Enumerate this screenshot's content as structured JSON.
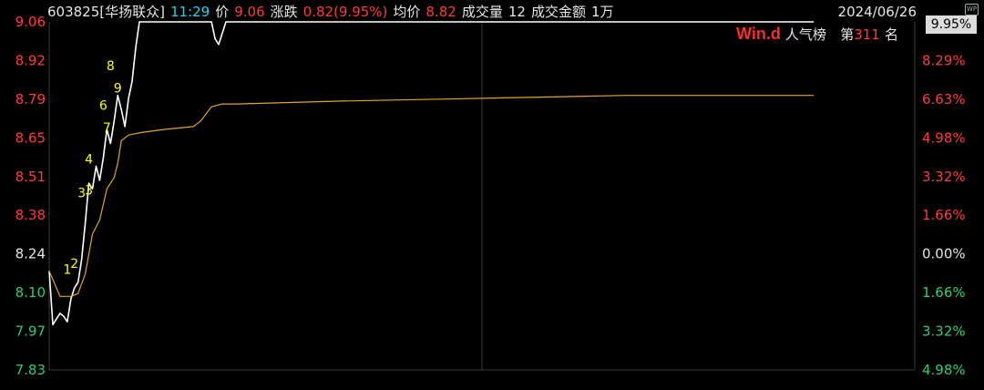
{
  "header": {
    "code_name": "603825[华扬联众]",
    "time": "11:29",
    "price_label": "价",
    "price": "9.06",
    "change_label": "涨跌",
    "change": "0.82(9.95%)",
    "avg_label": "均价",
    "avg": "8.82",
    "volume_label": "成交量",
    "volume": "12",
    "amount_label": "成交金额",
    "amount": "1万",
    "date": "2024/06/26",
    "wp_badge": "WP"
  },
  "current_pct_box": "9.95%",
  "popularity": {
    "brand": "Win.d",
    "label": "人气榜",
    "prefix": "第",
    "rank": "311",
    "suffix": "名"
  },
  "colors": {
    "up": "#ff3a3a",
    "down": "#2ecc71",
    "neutral": "#e6e6e6",
    "price_line": "#ffffff",
    "avg_line": "#e0a526",
    "marker": "#ffff00",
    "grid": "#3a3a3a"
  },
  "chart_data": {
    "type": "line",
    "title": "",
    "prev_close": 8.24,
    "ylim": [
      7.83,
      9.06
    ],
    "left_ticks": [
      "9.06",
      "8.92",
      "8.79",
      "8.65",
      "8.51",
      "8.38",
      "8.24",
      "8.10",
      "7.97",
      "7.83"
    ],
    "right_ticks": [
      "9.95%",
      "8.29%",
      "6.63%",
      "4.98%",
      "3.32%",
      "1.66%",
      "0.00%",
      "1.66%",
      "3.32%",
      "4.98%"
    ],
    "session_minutes": 240,
    "series": [
      {
        "key": "price",
        "points": [
          [
            0,
            8.18
          ],
          [
            1,
            7.99
          ],
          [
            2,
            8.01
          ],
          [
            3,
            8.03
          ],
          [
            4,
            8.02
          ],
          [
            5,
            8.0
          ],
          [
            6,
            8.08
          ],
          [
            7,
            8.12
          ],
          [
            8,
            8.14
          ],
          [
            9,
            8.22
          ],
          [
            10,
            8.35
          ],
          [
            11,
            8.49
          ],
          [
            12,
            8.47
          ],
          [
            13,
            8.55
          ],
          [
            14,
            8.5
          ],
          [
            15,
            8.58
          ],
          [
            16,
            8.68
          ],
          [
            17,
            8.63
          ],
          [
            18,
            8.71
          ],
          [
            19,
            8.8
          ],
          [
            20,
            8.75
          ],
          [
            21,
            8.69
          ],
          [
            22,
            8.79
          ],
          [
            23,
            8.85
          ],
          [
            24,
            8.97
          ],
          [
            25,
            9.06
          ],
          [
            30,
            9.06
          ],
          [
            40,
            9.06
          ],
          [
            45,
            9.06
          ],
          [
            46,
            9.0
          ],
          [
            47,
            8.98
          ],
          [
            48,
            9.02
          ],
          [
            49,
            9.06
          ],
          [
            60,
            9.06
          ],
          [
            120,
            9.06
          ],
          [
            180,
            9.06
          ],
          [
            200,
            9.06
          ],
          [
            212,
            9.06
          ]
        ]
      },
      {
        "key": "avg",
        "points": [
          [
            0,
            8.18
          ],
          [
            3,
            8.09
          ],
          [
            6,
            8.09
          ],
          [
            8,
            8.1
          ],
          [
            10,
            8.17
          ],
          [
            12,
            8.31
          ],
          [
            14,
            8.36
          ],
          [
            16,
            8.47
          ],
          [
            18,
            8.51
          ],
          [
            19,
            8.56
          ],
          [
            20,
            8.64
          ],
          [
            22,
            8.66
          ],
          [
            26,
            8.67
          ],
          [
            32,
            8.68
          ],
          [
            40,
            8.69
          ],
          [
            42,
            8.71
          ],
          [
            45,
            8.76
          ],
          [
            48,
            8.77
          ],
          [
            52,
            8.77
          ],
          [
            80,
            8.78
          ],
          [
            120,
            8.79
          ],
          [
            160,
            8.8
          ],
          [
            200,
            8.8
          ],
          [
            212,
            8.8
          ]
        ]
      }
    ],
    "markers": [
      {
        "label": "1",
        "t": 5,
        "price": 8.17
      },
      {
        "label": "2",
        "t": 7,
        "price": 8.19
      },
      {
        "label": "3",
        "t": 9,
        "price": 8.44
      },
      {
        "label": "3",
        "t": 11,
        "price": 8.45
      },
      {
        "label": "4",
        "t": 11,
        "price": 8.56
      },
      {
        "label": "6",
        "t": 15,
        "price": 8.75
      },
      {
        "label": "7",
        "t": 16,
        "price": 8.67
      },
      {
        "label": "8",
        "t": 17,
        "price": 8.89
      },
      {
        "label": "9",
        "t": 19,
        "price": 8.81
      }
    ]
  }
}
